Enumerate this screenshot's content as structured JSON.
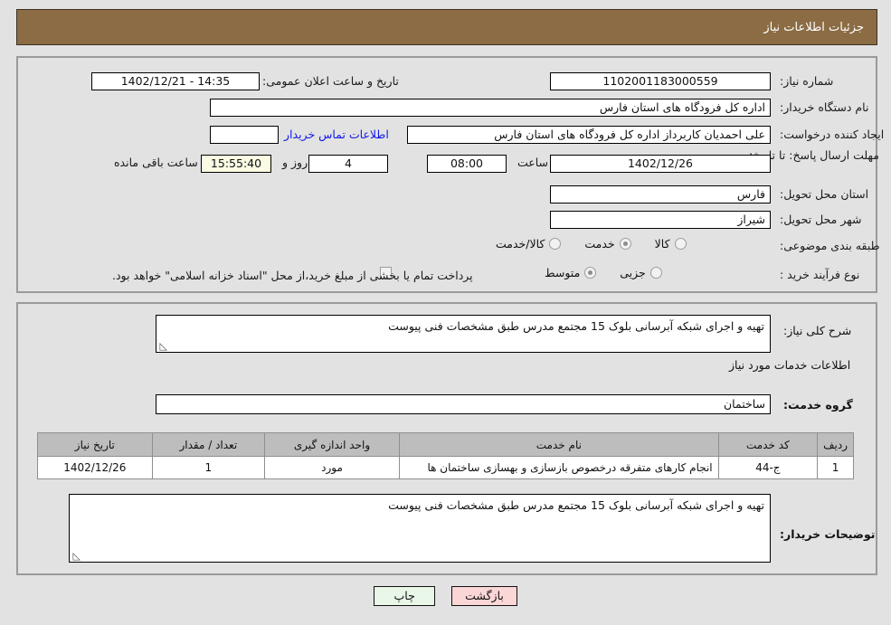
{
  "header": {
    "title": "جزئیات اطلاعات نیاز",
    "bg_color": "#8b6c44",
    "text_color": "#ffffff"
  },
  "watermark": {
    "text": "AriaTender.net"
  },
  "top_panel": {
    "need_number": {
      "label": "شماره نیاز:",
      "value": "1102001183000559"
    },
    "public_announce": {
      "label": "تاریخ و ساعت اعلان عمومی:",
      "value": "14:35 - 1402/12/21"
    },
    "buyer_org": {
      "label": "نام دستگاه خریدار:",
      "value": "اداره کل فرودگاه های استان فارس"
    },
    "request_creator": {
      "label": "ایجاد کننده درخواست:",
      "value": "علی  احمدیان کاربرداز اداره کل فرودگاه های استان فارس"
    },
    "buyer_contact_link": {
      "label": "اطلاعات تماس خریدار",
      "color": "#1318e8"
    },
    "deadline": {
      "label": "مهلت ارسال پاسخ: تا تاریخ:",
      "date": "1402/12/26",
      "time_label": "ساعت",
      "time": "08:00",
      "days": "4",
      "days_suffix": "روز و",
      "remaining": "15:55:40",
      "remaining_suffix": "ساعت باقی مانده",
      "remaining_bg": "#fbfbe4"
    },
    "province": {
      "label": "استان محل تحویل:",
      "value": "فارس"
    },
    "city": {
      "label": "شهر محل تحویل:",
      "value": "شیراز"
    },
    "classification": {
      "label": "طبقه بندی موضوعی:",
      "options": [
        {
          "label": "کالا",
          "selected": false
        },
        {
          "label": "خدمت",
          "selected": true
        },
        {
          "label": "کالا/خدمت",
          "selected": false
        }
      ]
    },
    "purchase_type": {
      "label": "نوع فرآیند خرید :",
      "options": [
        {
          "label": "جزیی",
          "selected": false
        },
        {
          "label": "متوسط",
          "selected": true
        }
      ],
      "checkbox": {
        "checked": false
      },
      "checkbox_text": "پرداخت تمام یا بخشی از مبلغ خرید،از محل \"اسناد خزانه اسلامی\" خواهد بود."
    }
  },
  "mid_panel": {
    "general_desc": {
      "label": "شرح کلی نیاز:",
      "value": "تهیه و اجرای شبکه آبرسانی بلوک 15 مجتمع مدرس طبق مشخصات فنی پیوست"
    },
    "services_heading": "اطلاعات خدمات مورد نیاز",
    "service_group": {
      "label": "گروه خدمت:",
      "value": "ساختمان"
    },
    "table": {
      "columns": [
        "ردیف",
        "کد خدمت",
        "نام خدمت",
        "واحد اندازه گیری",
        "تعداد / مقدار",
        "تاریخ نیاز"
      ],
      "rows": [
        {
          "radif": "1",
          "code": "ج-44",
          "name": "انجام کارهای متفرقه درخصوص بازسازی و بهسازی ساختمان ها",
          "unit": "مورد",
          "qty": "1",
          "date": "1402/12/26"
        }
      ]
    },
    "buyer_notes": {
      "label": "توضیحات خریدار:",
      "value": "تهیه و اجرای شبکه آبرسانی بلوک 15 مجتمع مدرس طبق مشخصات فنی پیوست"
    }
  },
  "buttons": {
    "print": {
      "label": "چاپ",
      "bg": "#e9f7e9"
    },
    "back": {
      "label": "بازگشت",
      "bg": "#fbd6d6"
    }
  }
}
